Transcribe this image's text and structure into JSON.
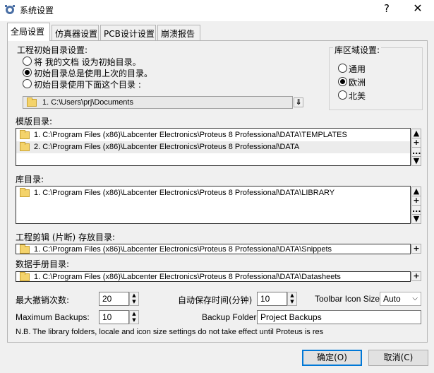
{
  "window": {
    "title": "系统设置",
    "help": "?",
    "close": "✕"
  },
  "tabs": [
    {
      "label": "全局设置"
    },
    {
      "label": "仿真器设置"
    },
    {
      "label": "PCB设计设置"
    },
    {
      "label": "崩溃报告"
    }
  ],
  "project_dir": {
    "heading": "工程初始目录设置:",
    "options": [
      {
        "label": "将 我的文档 设为初始目录。",
        "checked": false
      },
      {
        "label": "初始目录总是使用上次的目录。",
        "checked": true
      },
      {
        "label": "初始目录使用下面这个目录 :",
        "checked": false
      }
    ],
    "path_item": "1.  C:\\Users\\prj\\Documents",
    "browse_label": "⇓"
  },
  "locale": {
    "heading": "库区域设置:",
    "options": [
      {
        "label": "通用",
        "checked": false
      },
      {
        "label": "欧洲",
        "checked": true
      },
      {
        "label": "北美",
        "checked": false
      }
    ]
  },
  "template_dirs": {
    "heading": "模版目录:",
    "items": [
      "1.  C:\\Program Files (x86)\\Labcenter Electronics\\Proteus 8 Professional\\DATA\\TEMPLATES",
      "2.  C:\\Program Files (x86)\\Labcenter Electronics\\Proteus 8 Professional\\DATA"
    ]
  },
  "library_dirs": {
    "heading": "库目录:",
    "items": [
      "1.  C:\\Program Files (x86)\\Labcenter Electronics\\Proteus 8 Professional\\DATA\\LIBRARY"
    ]
  },
  "snippet_dirs": {
    "heading": "工程剪辑 (片断) 存放目录:",
    "items": [
      "1.  C:\\Program Files (x86)\\Labcenter Electronics\\Proteus 8 Professional\\DATA\\Snippets"
    ]
  },
  "datasheet_dirs": {
    "heading": "数据手册目录:",
    "items": [
      "1.  C:\\Program Files (x86)\\Labcenter Electronics\\Proteus 8 Professional\\DATA\\Datasheets"
    ]
  },
  "list_buttons": {
    "up": "▲",
    "add": "+",
    "edit": "...",
    "down": "▼"
  },
  "settings": {
    "max_undo_label": "最大撤销次数:",
    "max_undo_value": "20",
    "autosave_label": "自动保存时间(分钟)",
    "autosave_value": "10",
    "toolbar_icon_label": "Toolbar Icon Size:",
    "toolbar_icon_value": "Auto",
    "max_backups_label": "Maximum Backups:",
    "max_backups_value": "10",
    "backup_folder_label": "Backup Folder:",
    "backup_folder_value": "Project Backups",
    "note": "N.B. The library folders, locale and icon size settings do not take effect until Proteus is res"
  },
  "footer": {
    "ok": "确定(O)",
    "cancel": "取消(C)"
  }
}
